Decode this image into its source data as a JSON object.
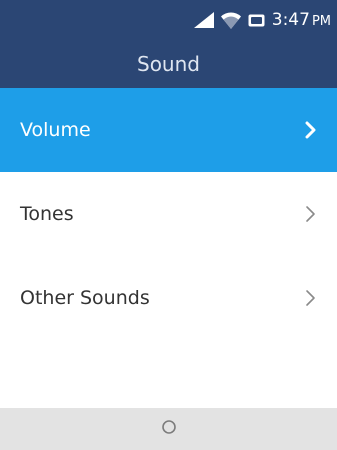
{
  "status_bar": {
    "time": "3:47",
    "ampm": "PM",
    "icons": [
      "signal-icon",
      "wifi-icon",
      "battery-icon"
    ]
  },
  "header": {
    "title": "Sound"
  },
  "menu": {
    "items": [
      {
        "label": "Volume",
        "selected": true
      },
      {
        "label": "Tones",
        "selected": false
      },
      {
        "label": "Other Sounds",
        "selected": false
      }
    ]
  },
  "softkeys": {
    "center_icon": "home-circle-icon"
  },
  "colors": {
    "header": "#2b4674",
    "selected": "#1e9ee8",
    "softkey_bar": "#e3e3e3"
  }
}
